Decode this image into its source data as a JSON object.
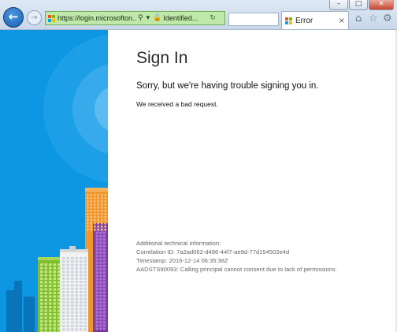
{
  "window": {
    "minimize_glyph": "–",
    "maximize_glyph": "□",
    "close_glyph": "✕"
  },
  "nav": {
    "back_icon": "←",
    "forward_icon": "→"
  },
  "address_bar": {
    "url": "https://login.microsofton...",
    "search_icon": "⚲",
    "dropdown_icon": "▾",
    "lock_icon": "🔒",
    "identity": "Identified...",
    "refresh_icon": "↻"
  },
  "tabs": [
    {
      "title": "Error",
      "close_glyph": "×"
    }
  ],
  "toolbar": {
    "home_icon": "⌂",
    "favorites_icon": "☆",
    "settings_icon": "⚙"
  },
  "page": {
    "title": "Sign In",
    "subtitle": "Sorry, but we're having trouble signing you in.",
    "message": "We received a bad request.",
    "technical": {
      "heading": "Additional technical information:",
      "correlation": "Correlation ID: 7a2ad062-d486-44f7-ae9d-77d154502e4d",
      "timestamp": "Timestamp: 2016-12-14 06:35:38Z",
      "error": "AADSTS90093: Calling principal cannot consent due to lack of permissions."
    }
  },
  "colors": {
    "illustration_blue": "#0d97e3",
    "address_bar_green": "#bfe8a9"
  }
}
